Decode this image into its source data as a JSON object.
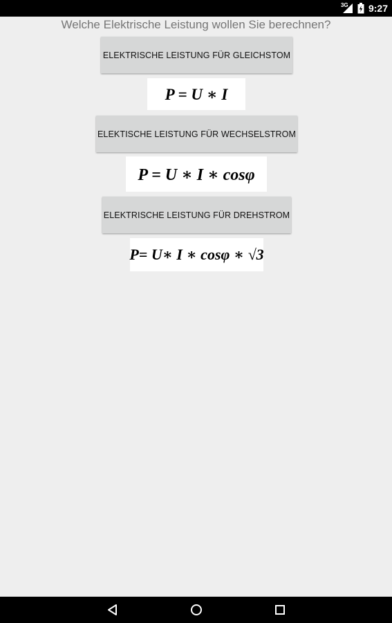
{
  "status_bar": {
    "network_type": "3G",
    "time": "9:27",
    "icons": [
      "signal-icon",
      "battery-icon"
    ]
  },
  "question": "Welche Elektrische Leistung wollen Sie berechnen?",
  "buttons": {
    "dc": "ELEKTRISCHE LEISTUNG FÜR GLEICHSTOM",
    "ac": "ELEKTISCHE LEISTUNG FÜR WECHSELSTROM",
    "three_phase": "ELEKTRISCHE LEISTUNG FÜR DREHSTROM"
  },
  "formulas": {
    "dc": "P = U ∗ I",
    "ac": "P = U ∗ I ∗ cosφ",
    "three_phase": "P= U∗ I ∗ cosφ ∗ √3"
  },
  "nav_bar": {
    "icons": [
      "back-icon",
      "home-icon",
      "recents-icon"
    ]
  },
  "colors": {
    "background": "#eeeeee",
    "button": "#d6d7d7",
    "question_text": "#757575",
    "bars": "#000000"
  }
}
